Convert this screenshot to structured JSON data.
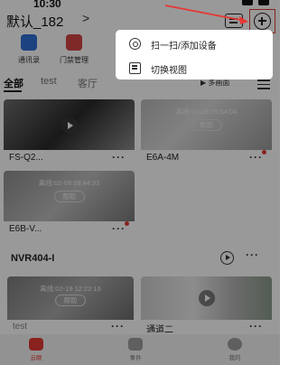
{
  "status_bar": {
    "time": "10:30"
  },
  "header": {
    "home_name": "默认_182",
    "chevron": ">"
  },
  "quick_actions": [
    {
      "label": "通讯录",
      "color": "#2f6fd6"
    },
    {
      "label": "门禁管理",
      "color": "#d64545"
    }
  ],
  "tabs": [
    {
      "label": "全部"
    },
    {
      "label": "test"
    },
    {
      "label": "客厅"
    }
  ],
  "view_toggle": "▶ 多画面",
  "devices": [
    {
      "name": "FS-Q2...",
      "offline_text": "",
      "help_label": "",
      "has_play": true,
      "has_dot": false
    },
    {
      "name": "E6A-4M",
      "offline_text": "离线:01-28 09:54:04",
      "help_label": "帮助",
      "has_play": false,
      "has_dot": true
    },
    {
      "name": "E6B-V...",
      "offline_text": "离线:02-09 09:44:33",
      "help_label": "帮助",
      "has_play": false,
      "has_dot": true
    }
  ],
  "more_label": "···",
  "nvr": {
    "title": "NVR404-I",
    "channels": [
      {
        "name": "test",
        "offline_text": "离线:02-19 12:22:16",
        "help_label": "帮助"
      },
      {
        "name": "通道二",
        "offline_text": "",
        "help_label": ""
      }
    ]
  },
  "bottom_nav": [
    {
      "label": "云眼",
      "active": true
    },
    {
      "label": "事件",
      "active": false
    },
    {
      "label": "我的",
      "active": false
    }
  ],
  "popup_menu": {
    "items": [
      {
        "label": "扫一扫/添加设备",
        "icon": "scan-icon"
      },
      {
        "label": "切换视图",
        "icon": "switch-view-icon"
      }
    ]
  },
  "colors": {
    "accent_red": "#e53935",
    "overlay": "rgba(0,0,0,0.40)"
  }
}
